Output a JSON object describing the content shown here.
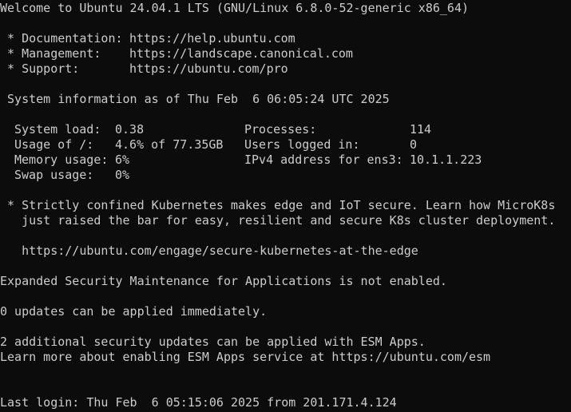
{
  "terminal": {
    "welcome": "Welcome to Ubuntu 24.04.1 LTS (GNU/Linux 6.8.0-52-generic x86_64)",
    "links": [
      {
        "label": " * Documentation:",
        "url": "https://help.ubuntu.com"
      },
      {
        "label": " * Management:",
        "url": "https://landscape.canonical.com"
      },
      {
        "label": " * Support:",
        "url": "https://ubuntu.com/pro"
      }
    ],
    "sysinfo_header": " System information as of Thu Feb  6 06:05:24 UTC 2025",
    "sysinfo": [
      {
        "label": "System load:",
        "value": "0.38",
        "label2": "Processes:",
        "value2": "114"
      },
      {
        "label": "Usage of /:",
        "value": "4.6% of 77.35GB",
        "label2": "Users logged in:",
        "value2": "0"
      },
      {
        "label": "Memory usage:",
        "value": "6%",
        "label2": "IPv4 address for ens3:",
        "value2": "10.1.1.223"
      },
      {
        "label": "Swap usage:",
        "value": "0%",
        "label2": "",
        "value2": ""
      }
    ],
    "microk8s_line1": " * Strictly confined Kubernetes makes edge and IoT secure. Learn how MicroK8s",
    "microk8s_line2": "   just raised the bar for easy, resilient and secure K8s cluster deployment.",
    "microk8s_url": "   https://ubuntu.com/engage/secure-kubernetes-at-the-edge",
    "esm_status": "Expanded Security Maintenance for Applications is not enabled.",
    "updates": "0 updates can be applied immediately.",
    "security_updates": "2 additional security updates can be applied with ESM Apps.",
    "esm_learn": "Learn more about enabling ESM Apps service at https://ubuntu.com/esm",
    "last_login": "Last login: Thu Feb  6 05:15:06 2025 from 201.171.4.124"
  },
  "colors": {
    "background": "#0c0c0c",
    "text": "#cccccc"
  }
}
